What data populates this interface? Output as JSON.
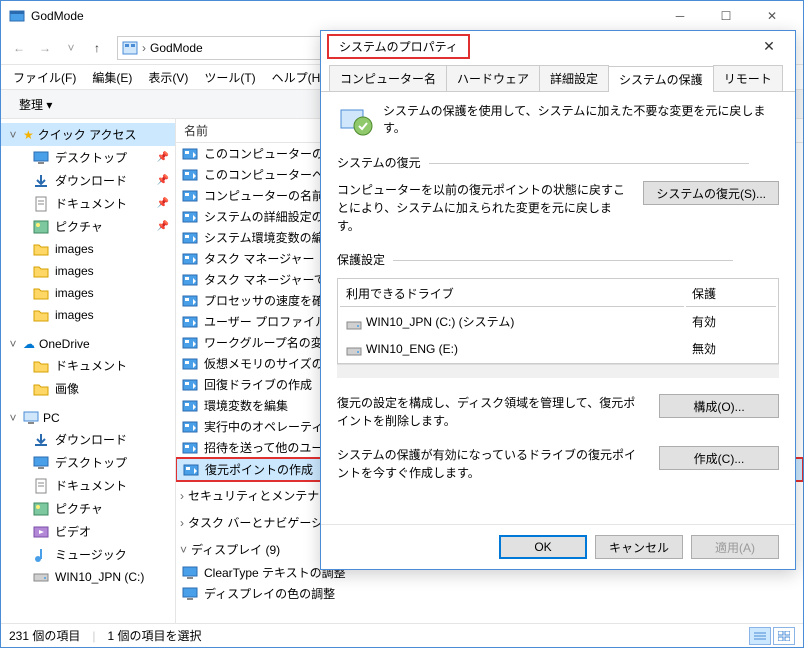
{
  "window": {
    "title": "GodMode"
  },
  "addressbar": {
    "root_icon": "control-panel-icon",
    "crumb1": "GodMode"
  },
  "menus": [
    "ファイル(F)",
    "編集(E)",
    "表示(V)",
    "ツール(T)",
    "ヘルプ(H)"
  ],
  "toolbar": {
    "organize": "整理 ▾"
  },
  "nav": {
    "quick_access": "クイック アクセス",
    "qa_items": [
      {
        "label": "デスクトップ",
        "icon": "desktop",
        "pin": true
      },
      {
        "label": "ダウンロード",
        "icon": "download",
        "pin": true
      },
      {
        "label": "ドキュメント",
        "icon": "document",
        "pin": true
      },
      {
        "label": "ピクチャ",
        "icon": "picture",
        "pin": true
      },
      {
        "label": "images",
        "icon": "folder",
        "pin": false
      },
      {
        "label": "images",
        "icon": "folder",
        "pin": false
      },
      {
        "label": "images",
        "icon": "folder",
        "pin": false
      },
      {
        "label": "images",
        "icon": "folder",
        "pin": false
      }
    ],
    "onedrive": "OneDrive",
    "od_items": [
      {
        "label": "ドキュメント",
        "icon": "folder"
      },
      {
        "label": "画像",
        "icon": "folder"
      }
    ],
    "pc": "PC",
    "pc_items": [
      {
        "label": "ダウンロード",
        "icon": "download"
      },
      {
        "label": "デスクトップ",
        "icon": "desktop"
      },
      {
        "label": "ドキュメント",
        "icon": "document"
      },
      {
        "label": "ピクチャ",
        "icon": "picture"
      },
      {
        "label": "ビデオ",
        "icon": "video"
      },
      {
        "label": "ミュージック",
        "icon": "music"
      },
      {
        "label": "WIN10_JPN (C:)",
        "icon": "drive"
      }
    ]
  },
  "content": {
    "col_name": "名前",
    "items": [
      "このコンピューターの名前",
      "このコンピューターへのリモ",
      "コンピューターの名前の参",
      "システムの詳細設定の表",
      "システム環境変数の編集",
      "タスク マネージャー",
      "タスク マネージャーでシス",
      "プロセッサの速度を確認",
      "ユーザー プロファイルの詳",
      "ワークグループ名の変更",
      "仮想メモリのサイズの変",
      "回復ドライブの作成",
      "環境変数を編集",
      "実行中のオペレーティン",
      "招待を送って他のユーザ",
      "復元ポイントの作成"
    ],
    "cat_security": "セキュリティとメンテナン",
    "cat_taskbar": "タスク バーとナビゲーショ",
    "cat_display": "ディスプレイ (9)",
    "disp_items": [
      "ClearType テキストの調整",
      "ディスプレイの色の調整"
    ]
  },
  "status": {
    "count": "231 個の項目",
    "sel": "1 個の項目を選択"
  },
  "dialog": {
    "title": "システムのプロパティ",
    "tabs": [
      "コンピューター名",
      "ハードウェア",
      "詳細設定",
      "システムの保護",
      "リモート"
    ],
    "active_tab": 3,
    "intro": "システムの保護を使用して、システムに加えた不要な変更を元に戻します。",
    "restore_title": "システムの復元",
    "restore_desc": "コンピューターを以前の復元ポイントの状態に戻すことにより、システムに加えられた変更を元に戻します。",
    "restore_btn": "システムの復元(S)...",
    "prot_title": "保護設定",
    "drive_col1": "利用できるドライブ",
    "drive_col2": "保護",
    "drives": [
      {
        "name": "WIN10_JPN (C:) (システム)",
        "status": "有効"
      },
      {
        "name": "WIN10_ENG (E:)",
        "status": "無効"
      }
    ],
    "cfg_desc": "復元の設定を構成し、ディスク領域を管理して、復元ポイントを削除します。",
    "cfg_btn": "構成(O)...",
    "create_desc": "システムの保護が有効になっているドライブの復元ポイントを今すぐ作成します。",
    "create_btn": "作成(C)...",
    "ok": "OK",
    "cancel": "キャンセル",
    "apply": "適用(A)"
  }
}
